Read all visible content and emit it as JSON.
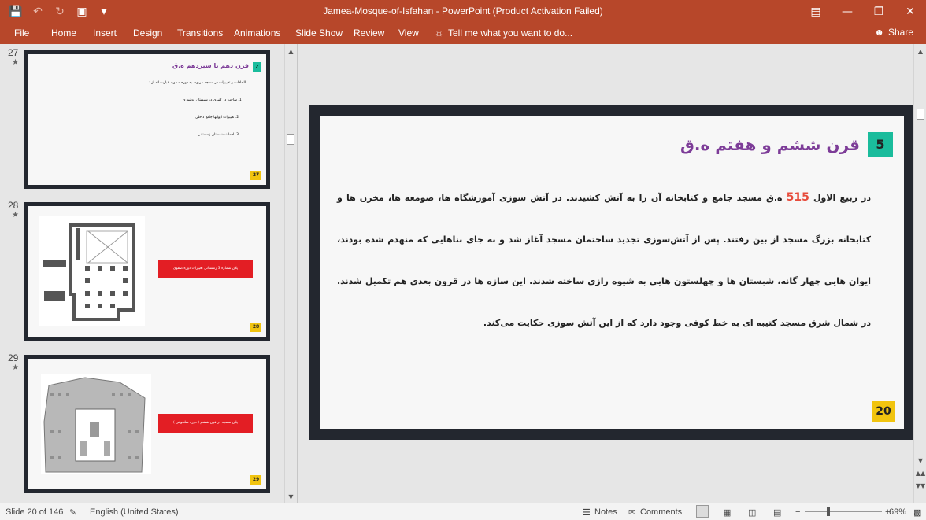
{
  "window": {
    "title": "Jamea-Mosque-of-Isfahan - PowerPoint (Product Activation Failed)",
    "accent": "#b7472a"
  },
  "quick_access": {
    "icons": [
      "save-icon",
      "undo-icon",
      "redo-icon",
      "present-icon",
      "customize-icon"
    ]
  },
  "ribbon": {
    "file": "File",
    "tabs": [
      "Home",
      "Insert",
      "Design",
      "Transitions",
      "Animations",
      "Slide Show",
      "Review",
      "View"
    ],
    "tell_me": "Tell me what you want to do...",
    "share": "Share"
  },
  "thumbnails": [
    {
      "number": "27",
      "title": "قرن دهم تا سیزدهم ه.ق",
      "badge_number": "7",
      "subtitle": "الحاقات و تغییرات در مسجد مربوط به دوره صفویه عبارت اند از :",
      "items": [
        "1. ساخت در گنبدی در شبستان اوشوری",
        "2. تغییرات ایوانها جامع داخلی",
        "3. احداث شبستان زمستانی"
      ],
      "page": "27"
    },
    {
      "number": "28",
      "caption": "پلان شماره 3 زمستانی تغییرات دوره صفوی",
      "page": "28"
    },
    {
      "number": "29",
      "caption": "پلان مسجد در قرن ششم ( دوره سلجوقی )",
      "page": "29"
    }
  ],
  "slide": {
    "number_box": "5",
    "title": "قرن ششم و هفتم ه.ق",
    "body_pre": "در ربیع الاول ",
    "body_highlight": "515",
    "body_post": " ه.ق مسجد جامع و کتابخانه آن را به آتش کشیدند. در آتش سوزی آموزشگاه ها، صومعه ها، مخزن ها و کتابخانه بزرگ مسجد از بین رفتند. پس از آتش‌سوزی تجدید ساختمان مسجد آغاز شد و به جای بناهایی که منهدم شده بودند، ایوان هایی چهار گانه، شبستان ها و چهلستون هایی به شیوه رازی ساخته شدند. این سازه ها در قرون بعدی هم تکمیل شدند. در شمال شرق مسجد کتیبه ای به خط کوفی وجود دارد که از این آتش سوزی حکایت می‌کند.",
    "page_badge": "20"
  },
  "status": {
    "slide_info": "Slide 20 of 146",
    "language": "English (United States)",
    "notes": "Notes",
    "comments": "Comments",
    "zoom": "69%"
  }
}
